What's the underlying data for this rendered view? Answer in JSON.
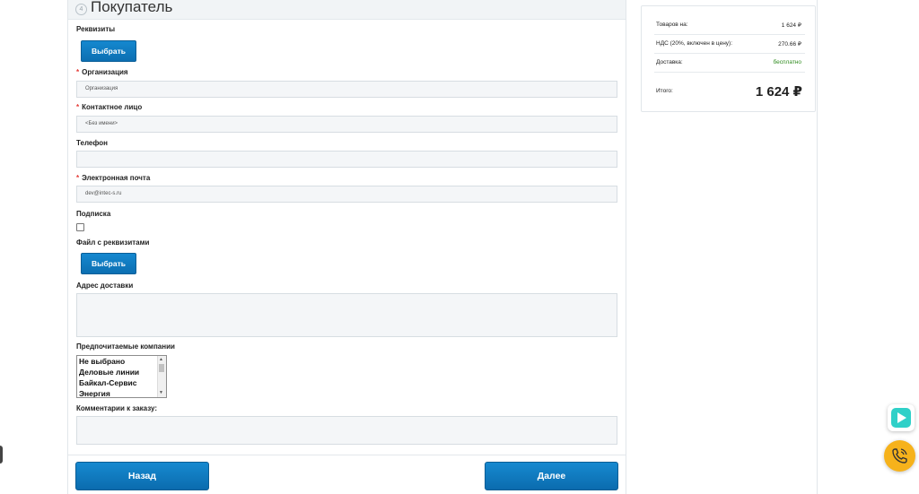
{
  "section": {
    "step": "4",
    "title": "Покупатель"
  },
  "requisites": {
    "label": "Реквизиты",
    "button": "Выбрать"
  },
  "organization": {
    "label": "Организация",
    "required_mark": "*",
    "value": "Организация"
  },
  "contact": {
    "label": "Контактное лицо",
    "required_mark": "*",
    "value": "<Без имени>"
  },
  "phone": {
    "label": "Телефон",
    "value": ""
  },
  "email": {
    "label": "Электронная почта",
    "required_mark": "*",
    "value": "dev@intec-s.ru"
  },
  "subscription": {
    "label": "Подписка",
    "checked": false
  },
  "requisites_file": {
    "label": "Файл с реквизитами",
    "button": "Выбрать"
  },
  "delivery_address": {
    "label": "Адрес доставки",
    "value": ""
  },
  "preferred_companies": {
    "label": "Предпочитаемые компании",
    "options": [
      "Не выбрано",
      "Деловые линии",
      "Байкал-Сервис",
      "Энергия"
    ]
  },
  "order_comment": {
    "label": "Комментарии к заказу:",
    "value": ""
  },
  "navigation": {
    "back": "Назад",
    "next": "Далее"
  },
  "summary": {
    "goods_label": "Товаров на:",
    "goods_value": "1 624 ₽",
    "vat_label": "НДС (20%, включен в цену):",
    "vat_value": "270.66 ₽",
    "delivery_label": "Доставка:",
    "delivery_value": "бесплатно",
    "total_label": "Итого:",
    "total_value": "1 624 ₽"
  },
  "colors": {
    "accent_button": "#0c6fb2",
    "free_delivery": "#2e8b1e",
    "call_widget": "#f6b21b",
    "chat_widget": "#2fd0c8"
  },
  "icons": [
    "chat-widget-icon",
    "phone-call-icon",
    "scroll-up-arrow-icon",
    "scroll-down-arrow-icon"
  ]
}
